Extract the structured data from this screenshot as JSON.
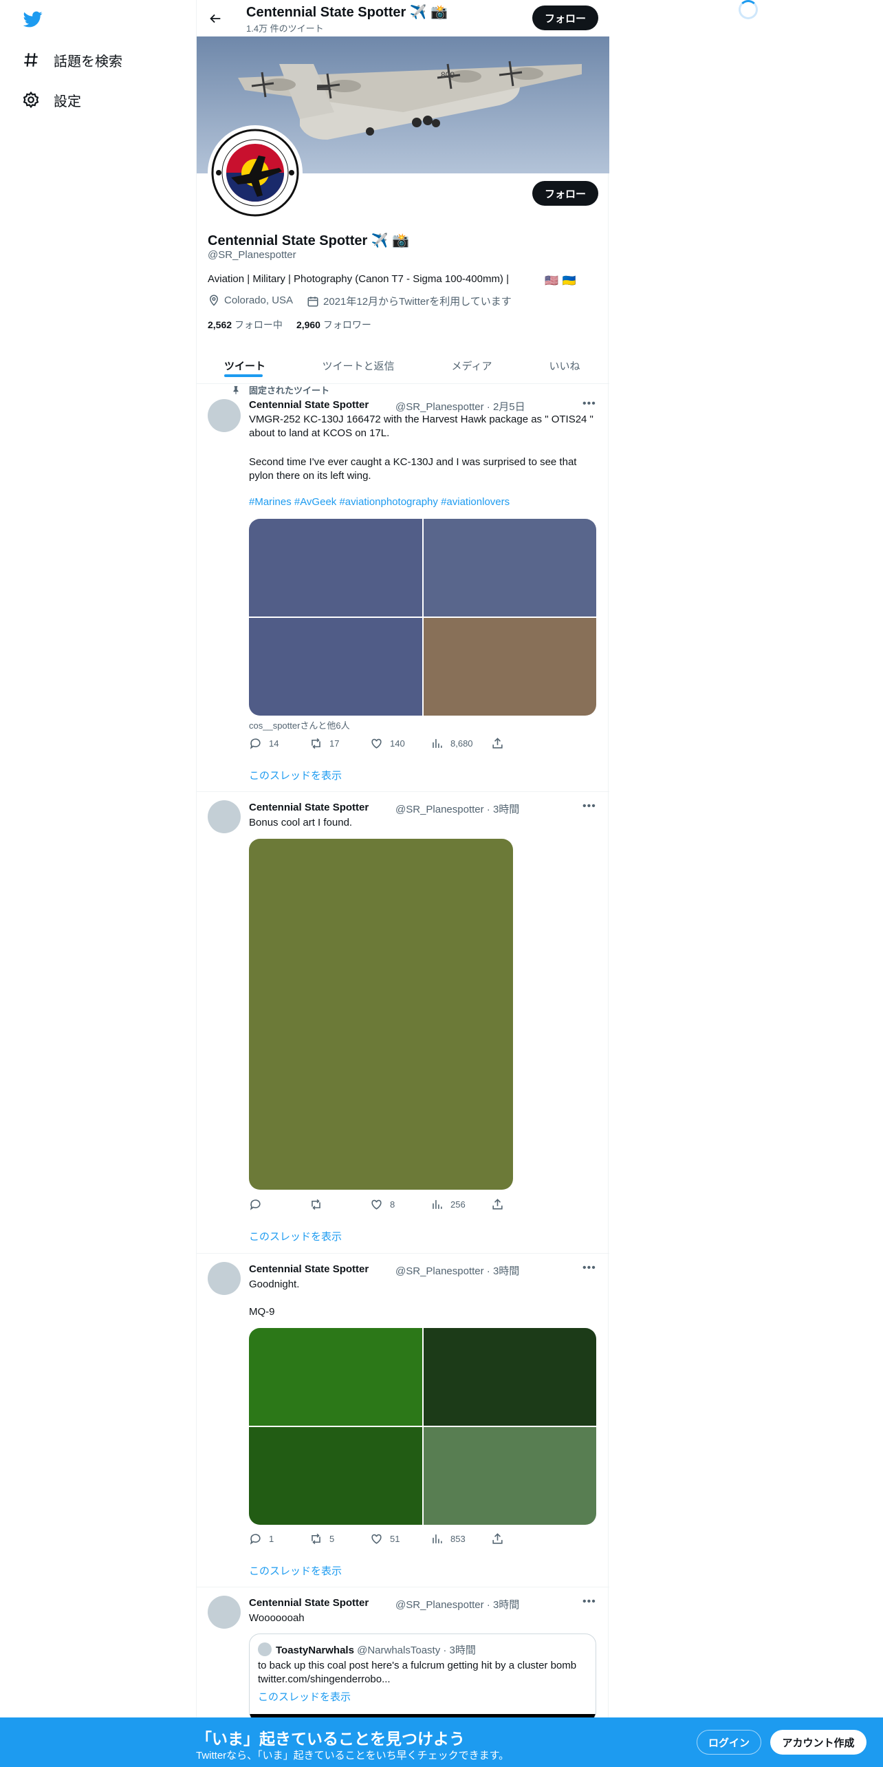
{
  "nav": {
    "explore_label": "話題を検索",
    "settings_label": "設定"
  },
  "header": {
    "title": "Centennial State Spotter ✈️ 📸",
    "tweet_count": "1.4万 件のツイート",
    "follow_label": "フォロー"
  },
  "profile": {
    "name": "Centennial State Spotter ✈️ 📸",
    "handle": "@SR_Planespotter",
    "bio": "Aviation | Military | Photography (Canon T7 - Sigma 100-400mm) |",
    "flags": [
      "🇺🇸",
      "🇺🇦"
    ],
    "location": "Colorado, USA",
    "joined": "2021年12月からTwitterを利用しています",
    "following_count": "2,562",
    "following_label": "フォロー中",
    "followers_count": "2,960",
    "followers_label": "フォロワー",
    "follow_label": "フォロー"
  },
  "tabs": [
    {
      "label": "ツイート",
      "active": true
    },
    {
      "label": "ツイートと返信",
      "active": false
    },
    {
      "label": "メディア",
      "active": false
    },
    {
      "label": "いいね",
      "active": false
    }
  ],
  "tweets": [
    {
      "pinned_label": "固定されたツイート",
      "author": "Centennial State Spotter",
      "meta": "@SR_Planespotter · 2月5日",
      "text1": "VMGR-252 KC-130J 166472 with the Harvest Hawk package as \" OTIS24 \" about to land at KCOS on 17L.",
      "text2": "Second time I've ever caught a KC-130J and I was surprised to see that pylon there on its left wing.",
      "hashtags": "#Marines #AvGeek #aviationphotography #aviationlovers",
      "media_colors": [
        "#525e88",
        "#59668c",
        "#505c87",
        "#887058"
      ],
      "tagged": "cos__spotterさんと他6人",
      "replies": "14",
      "retweets": "17",
      "likes": "140",
      "views": "8,680",
      "thread_link": "このスレッドを表示"
    },
    {
      "author": "Centennial State Spotter",
      "meta": "@SR_Planespotter · 3時間",
      "text": "Bonus cool art I found.",
      "media_colors": [
        "#6c7a38"
      ],
      "replies": "",
      "retweets": "",
      "likes": "8",
      "views": "256",
      "thread_link": "このスレッドを表示"
    },
    {
      "author": "Centennial State Spotter",
      "meta": "@SR_Planespotter · 3時間",
      "text1": "Goodnight.",
      "text2": "MQ-9",
      "media_colors": [
        "#2c7818",
        "#1c3b18",
        "#225c14",
        "#587e52"
      ],
      "replies": "1",
      "retweets": "5",
      "likes": "51",
      "views": "853",
      "thread_link": "このスレッドを表示"
    },
    {
      "author": "Centennial State Spotter",
      "meta": "@SR_Planespotter · 3時間",
      "text": "Wooooooah",
      "quote": {
        "author": "ToastyNarwhals",
        "meta": "@NarwhalsToasty · 3時間",
        "text": "to back up this coal post here's a fulcrum getting hit by a cluster bomb twitter.com/shingenderrobo...",
        "thread_link": "このスレッドを表示"
      }
    }
  ],
  "bottom_bar": {
    "title": "「いま」起きていることを見つけよう",
    "subtitle": "Twitterなら、「いま」起きていることをいち早くチェックできます。",
    "login_label": "ログイン",
    "signup_label": "アカウント作成"
  },
  "colors": {
    "accent": "#1d9bf0",
    "text": "#0f1419",
    "secondary": "#536471"
  }
}
